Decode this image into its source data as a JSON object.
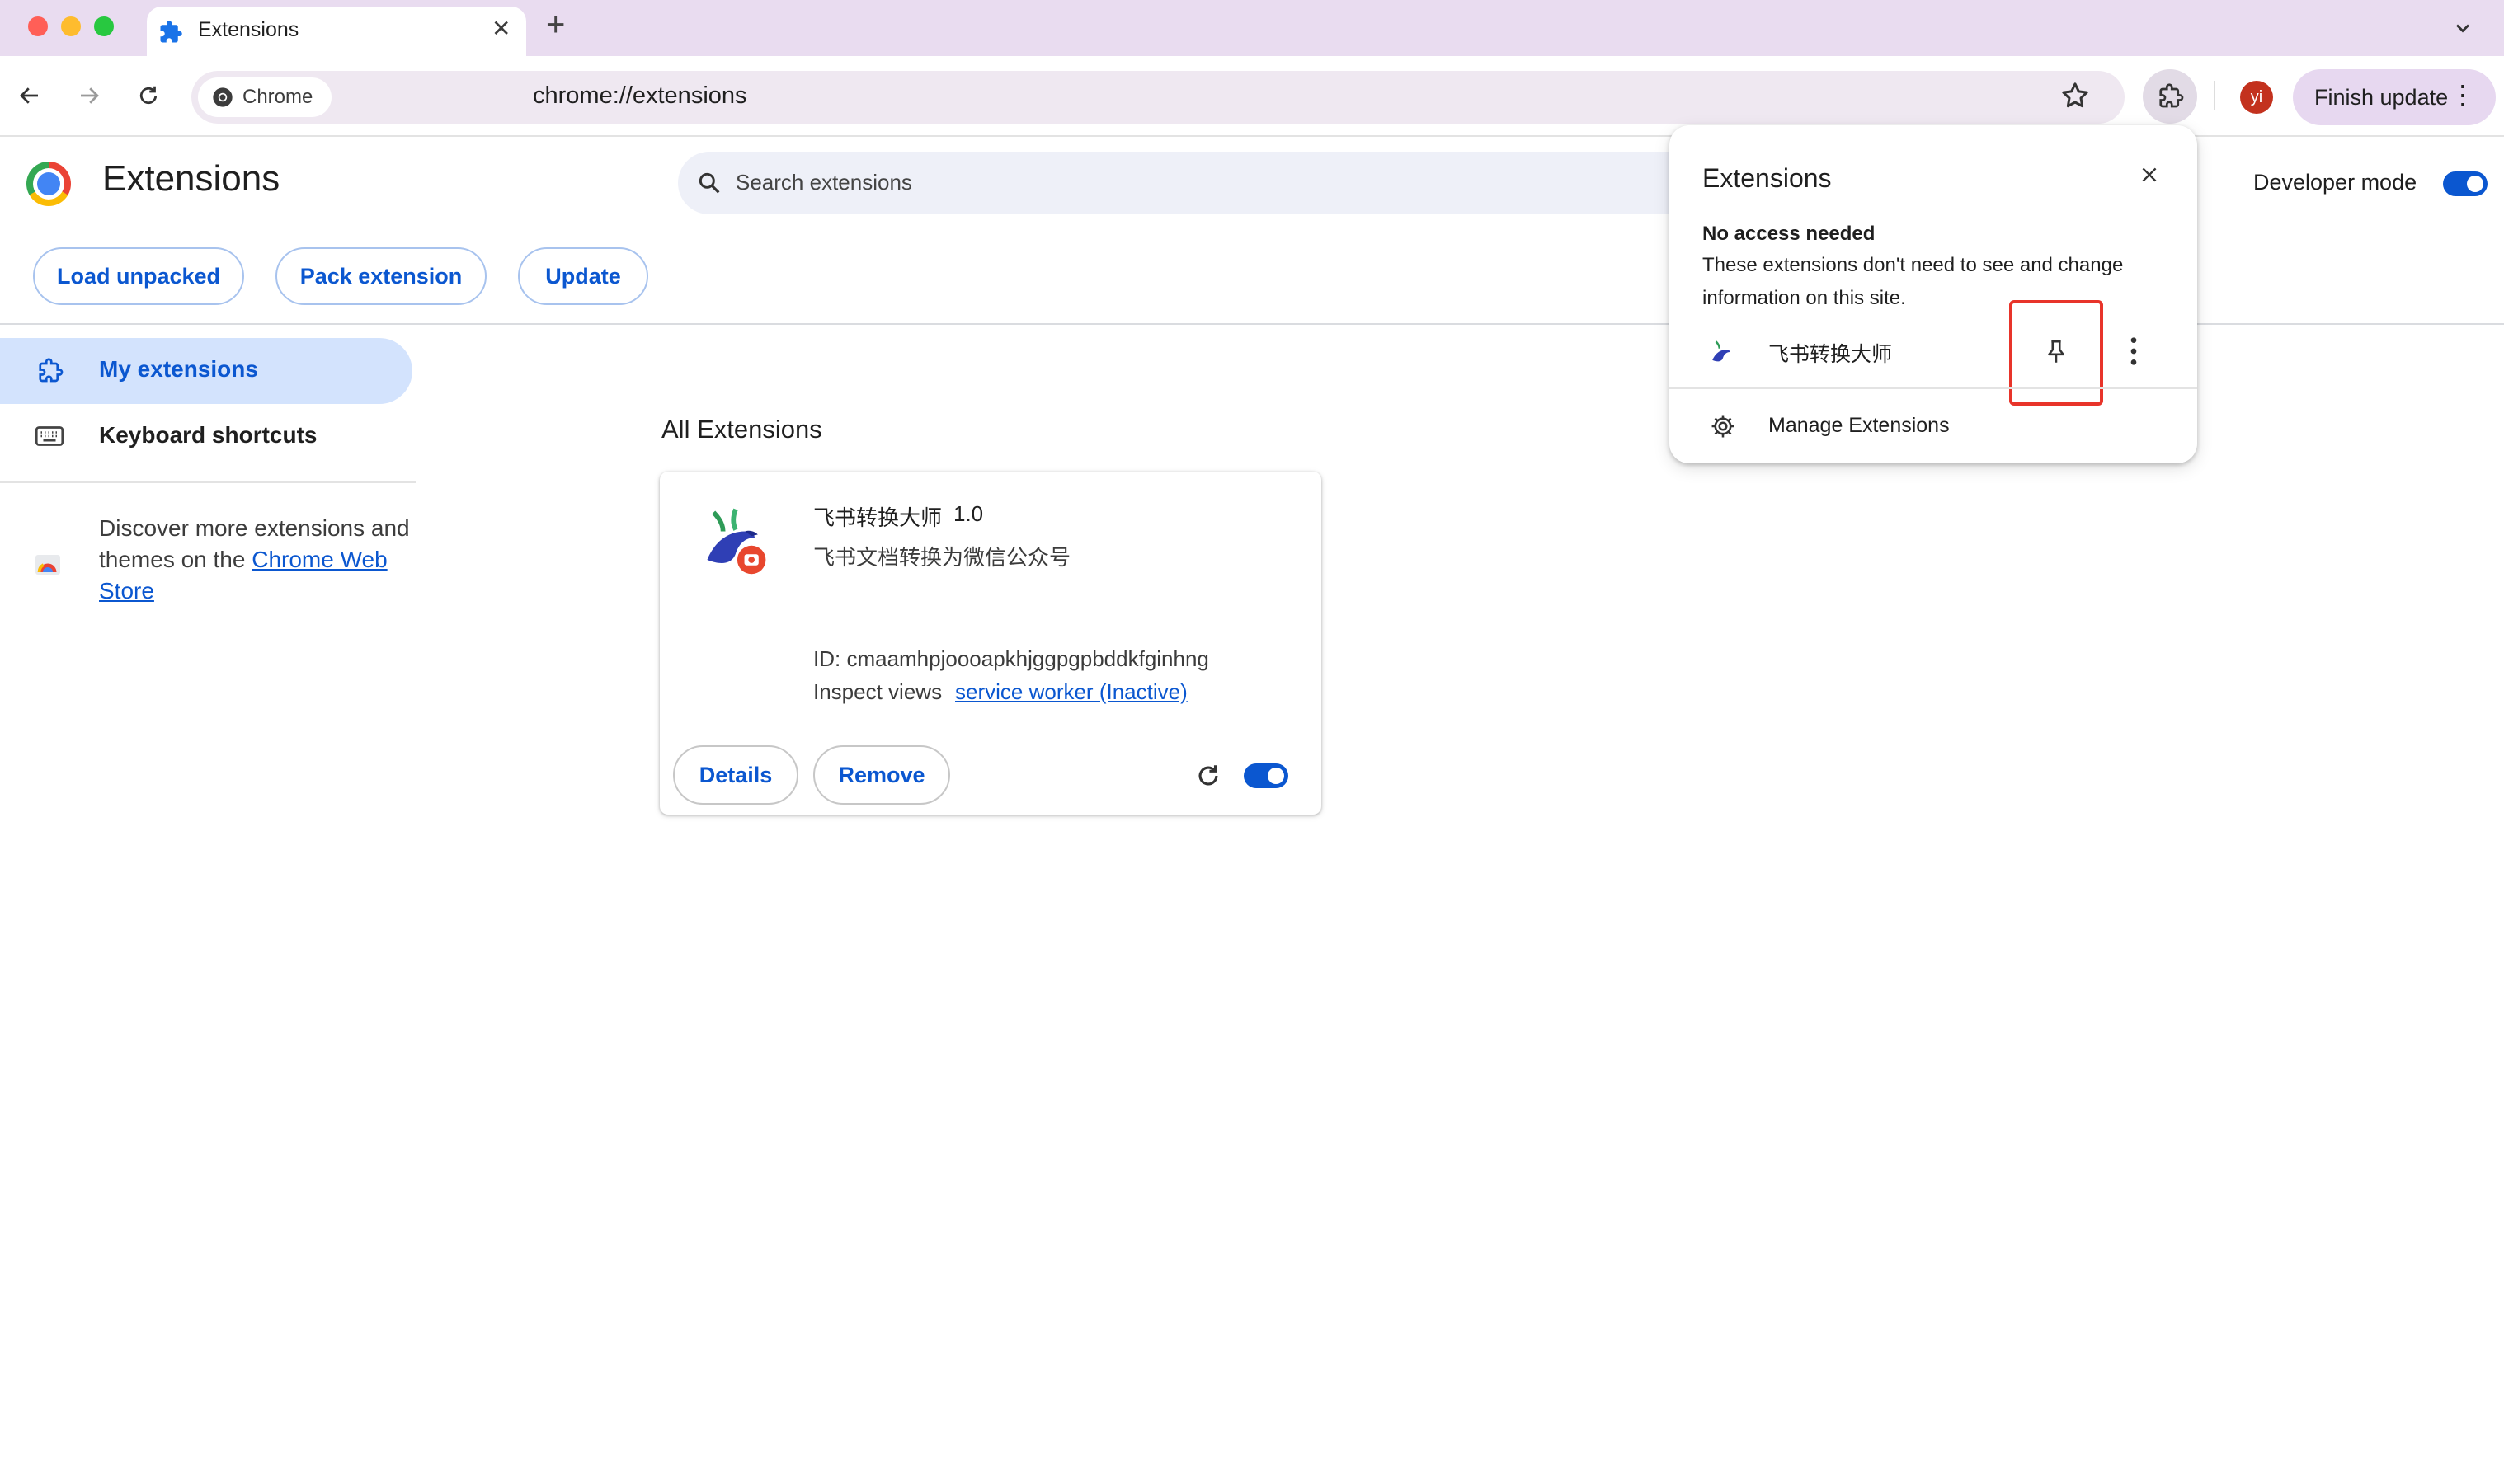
{
  "browser": {
    "tab_title": "Extensions",
    "url_chip": "Chrome",
    "url": "chrome://extensions",
    "profile_initial": "yi",
    "finish_update_label": "Finish update"
  },
  "page": {
    "title": "Extensions",
    "search_placeholder": "Search extensions",
    "developer_mode_label": "Developer mode",
    "developer_mode_on": true,
    "actions": {
      "load_unpacked": "Load unpacked",
      "pack_extension": "Pack extension",
      "update": "Update"
    }
  },
  "sidebar": {
    "items": [
      {
        "label": "My extensions",
        "icon": "extension-icon",
        "active": true
      },
      {
        "label": "Keyboard shortcuts",
        "icon": "keyboard-icon",
        "active": false
      }
    ],
    "discover_prefix": "Discover more extensions and themes on the ",
    "discover_link": "Chrome Web Store"
  },
  "main": {
    "section_title": "All Extensions",
    "card": {
      "name": "飞书转换大师",
      "version": "1.0",
      "description": "飞书文档转换为微信公众号",
      "id_text": "ID: cmaamhpjoooapkhjggpgpbddkfginhng",
      "inspect_label": "Inspect views",
      "inspect_link": "service worker (Inactive)",
      "details_label": "Details",
      "remove_label": "Remove",
      "enabled": true
    }
  },
  "popup": {
    "title": "Extensions",
    "section_title": "No access needed",
    "section_text": "These extensions don't need to see and change information on this site.",
    "extension_name": "飞书转换大师",
    "manage_label": "Manage Extensions"
  },
  "colors": {
    "accent": "#0b57d0",
    "tabbar": "#e9dcf0",
    "highlight": "#e8342a"
  }
}
